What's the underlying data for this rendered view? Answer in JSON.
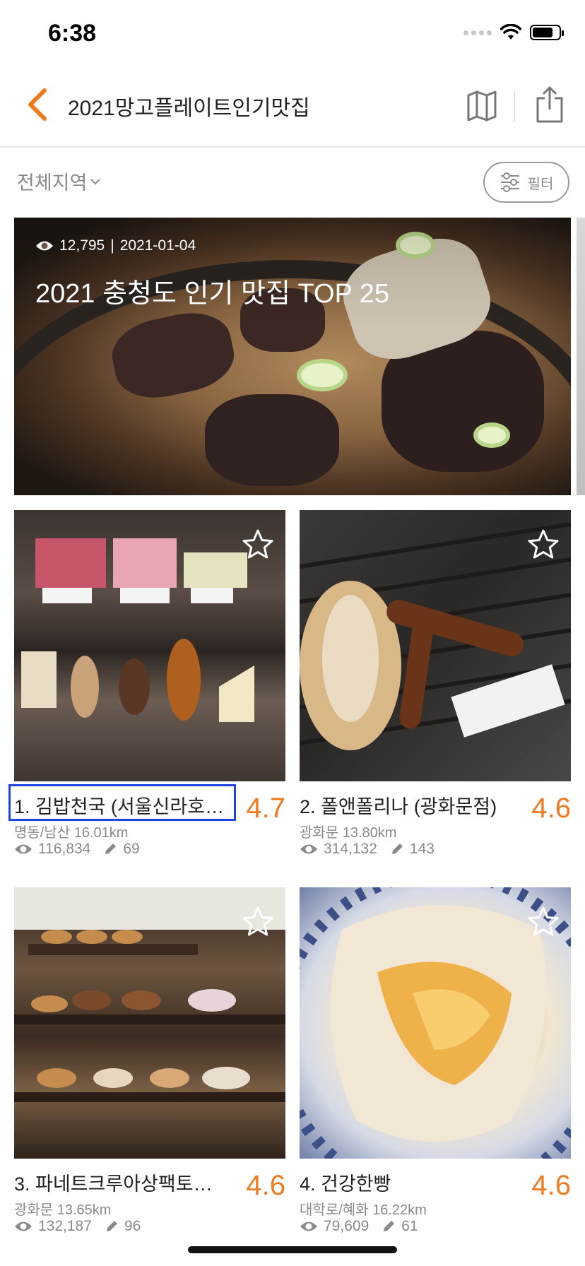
{
  "status_bar": {
    "time": "6:38"
  },
  "nav": {
    "title": "2021망고플레이트인기맛집"
  },
  "filter_row": {
    "region_label": "전체지역",
    "filter_label": "필터"
  },
  "banner": {
    "views": "12,795",
    "separator": "|",
    "date": "2021-01-04",
    "title": "2021 충청도 인기 맛집 TOP 25"
  },
  "restaurants": [
    {
      "name": "1. 김밥천국 (서울신라호…",
      "rating": "4.7",
      "location": "명동/남산 16.01km",
      "views": "116,834",
      "reviews": "69"
    },
    {
      "name": "2. 폴앤폴리나 (광화문점)",
      "rating": "4.6",
      "location": "광화문 13.80km",
      "views": "314,132",
      "reviews": "143"
    },
    {
      "name": "3. 파네트크루아상팩토…",
      "rating": "4.6",
      "location": "광화문 13.65km",
      "views": "132,187",
      "reviews": "96"
    },
    {
      "name": "4. 건강한빵",
      "rating": "4.6",
      "location": "대학로/혜화 16.22km",
      "views": "79,609",
      "reviews": "61"
    }
  ],
  "colors": {
    "accent": "#f07a20",
    "highlight": "#2244dd",
    "muted": "#8a8a8a"
  },
  "icons": [
    "back-arrow-icon",
    "map-icon",
    "share-icon",
    "chevron-down-icon",
    "filter-sliders-icon",
    "eye-icon",
    "pencil-icon",
    "star-outline-icon",
    "wifi-icon",
    "battery-icon"
  ]
}
